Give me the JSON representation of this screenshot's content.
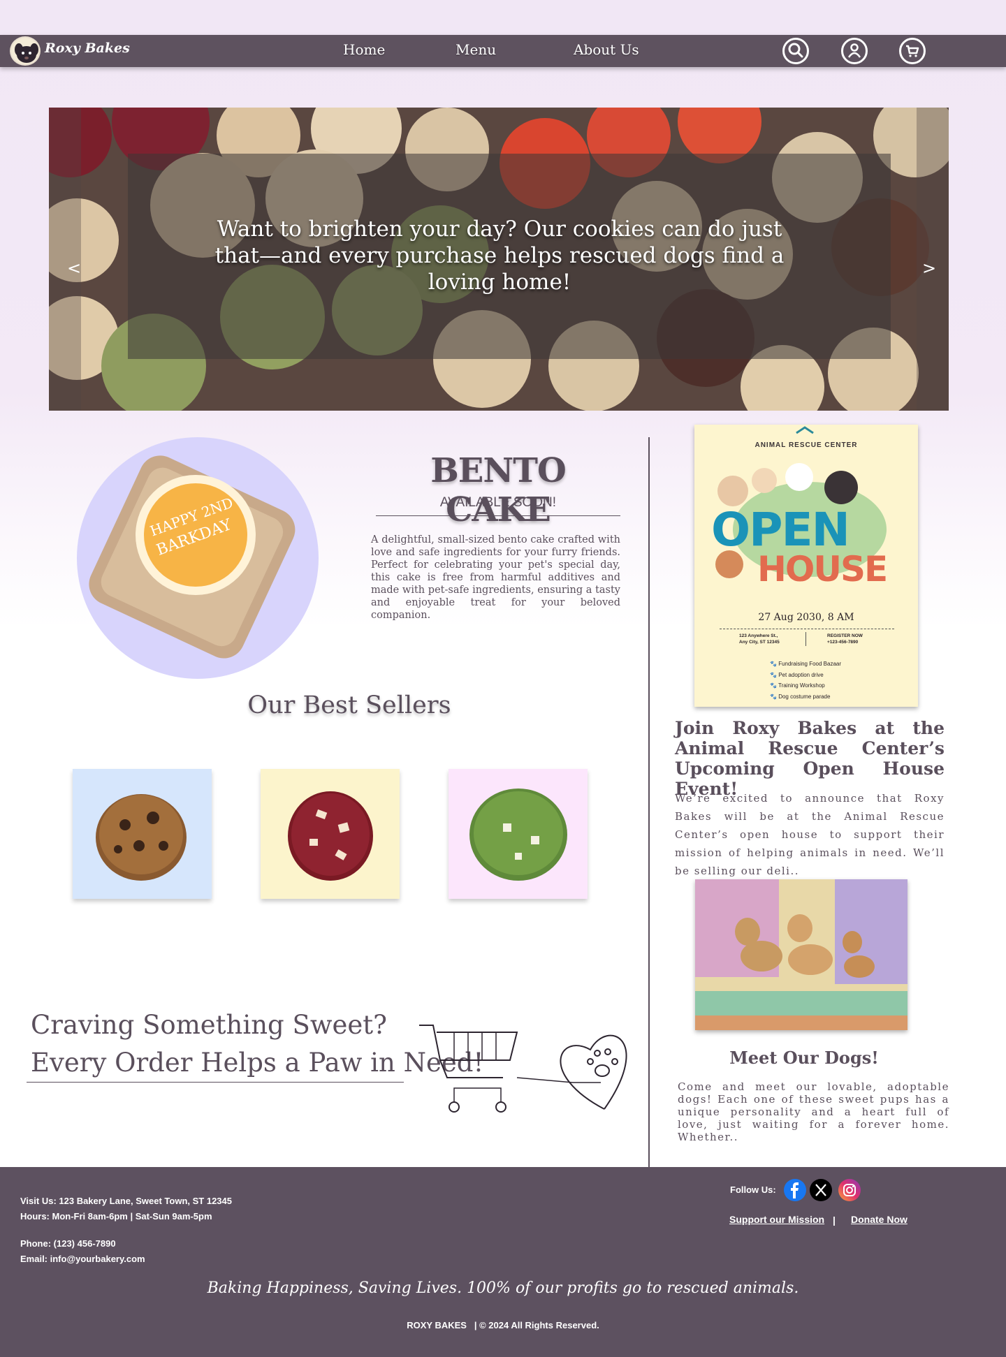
{
  "brand": {
    "name": "Roxy Bakes"
  },
  "nav": {
    "links": [
      {
        "label": "Home"
      },
      {
        "label": "Menu"
      },
      {
        "label": "About Us"
      }
    ],
    "icons": [
      "search-icon",
      "account-icon",
      "cart-icon"
    ]
  },
  "hero": {
    "text": "Want to brighten your day? Our cookies can do just that—and every purchase helps rescued dogs find a loving home!",
    "prev": "<",
    "next": ">"
  },
  "bento": {
    "title": "BENTO CAKE",
    "subtitle": "AVAILABLE SOON!",
    "cake_lettering": "HAPPY 2ND BARKDAY",
    "description": "A delightful, small-sized bento cake crafted with love and safe ingredients for your furry friends. Perfect for celebrating your pet's special day, this cake is free from harmful additives and made with pet-safe ingredients, ensuring a tasty and enjoyable treat for your beloved companion."
  },
  "best_sellers": {
    "title": "Our Best Sellers",
    "items": [
      {
        "name": "chocolate-chip-cookie",
        "bg": "#d6e6fc"
      },
      {
        "name": "red-velvet-cookie",
        "bg": "#fcf4cc"
      },
      {
        "name": "matcha-cookie",
        "bg": "#fce6fc"
      }
    ]
  },
  "craving": {
    "line1": "Craving Something Sweet?",
    "line2": "Every Order Helps a Paw in Need!"
  },
  "poster": {
    "org": "ANIMAL RESCUE CENTER",
    "headline1": "OPEN",
    "headline2": "HOUSE",
    "date": "27 Aug 2030, 8 AM",
    "address1": "123 Anywhere St.,",
    "address2": "Any City, ST 12345",
    "register": "REGISTER NOW",
    "phone": "+123-456-7890",
    "activities": [
      "Fundraising Food Bazaar",
      "Pet adoption drive",
      "Training Workshop",
      "Dog costume parade"
    ]
  },
  "event": {
    "title": "Join Roxy Bakes at the Animal Rescue Center’s Upcoming Open House Event!",
    "description": "We’re excited to announce that Roxy Bakes will be at the Animal Rescue Center’s open house to support their mission of helping animals in need. We’ll be selling our deli.."
  },
  "dogs": {
    "title": "Meet Our Dogs!",
    "description": "Come and meet our lovable, adoptable dogs! Each one of these sweet pups has a unique personality and a heart full of love, just waiting for a forever home. Whether.."
  },
  "footer": {
    "visit": "Visit Us: 123 Bakery Lane, Sweet Town, ST 12345",
    "hours": "Hours: Mon-Fri 8am-6pm | Sat-Sun 9am-5pm",
    "phone": "Phone: (123) 456-7890",
    "email": "Email: info@yourbakery.com",
    "follow": "Follow Us:",
    "support": "Support our Mission",
    "separator": "|",
    "donate": "Donate Now",
    "tagline": "Baking Happiness, Saving Lives. 100% of our profits go to rescued animals.",
    "copyright_brand": "ROXY BAKES",
    "copyright": "| © 2024 All Rights Reserved."
  },
  "colors": {
    "nav": "#5e525f",
    "text": "#5a4f5c",
    "footer": "#5d5160",
    "bento_circle": "#d8d4fc"
  }
}
